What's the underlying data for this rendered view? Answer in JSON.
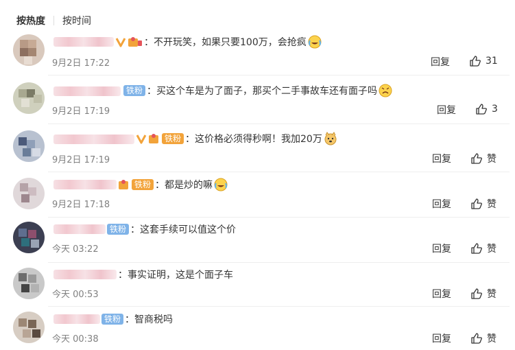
{
  "tabs": {
    "hot": "按热度",
    "time": "按时间"
  },
  "comments": [
    {
      "text": "：不开玩笑，如果只要100万，会抢疯",
      "badge": "",
      "time": "9月2日 17:22",
      "reply": "回复",
      "likes": "31"
    },
    {
      "text": "：买这个车是为了面子，那买个二手事故车还有面子吗",
      "badge": "铁粉",
      "time": "9月2日 17:19",
      "reply": "回复",
      "likes": "3"
    },
    {
      "text": "：这价格必须得秒啊！我加20万",
      "badge": "铁粉",
      "time": "9月2日 17:19",
      "reply": "回复",
      "likes": "赞"
    },
    {
      "text": "：都是炒的嘛",
      "badge": "铁粉",
      "time": "9月2日 17:18",
      "reply": "回复",
      "likes": "赞"
    },
    {
      "text": "：这套手续可以值这个价",
      "badge": "铁粉",
      "time": "今天 03:22",
      "reply": "回复",
      "likes": "赞"
    },
    {
      "text": "：事实证明，这是个面子车",
      "badge": "",
      "time": "今天 00:53",
      "reply": "回复",
      "likes": "赞"
    },
    {
      "text": "：智商税吗",
      "badge": "铁粉",
      "time": "今天 00:38",
      "reply": "回复",
      "likes": "赞"
    }
  ],
  "colors": {
    "accent_blue": "#7fb3e8",
    "vip_orange": "#f2a33a",
    "meta_gray": "#808080"
  }
}
